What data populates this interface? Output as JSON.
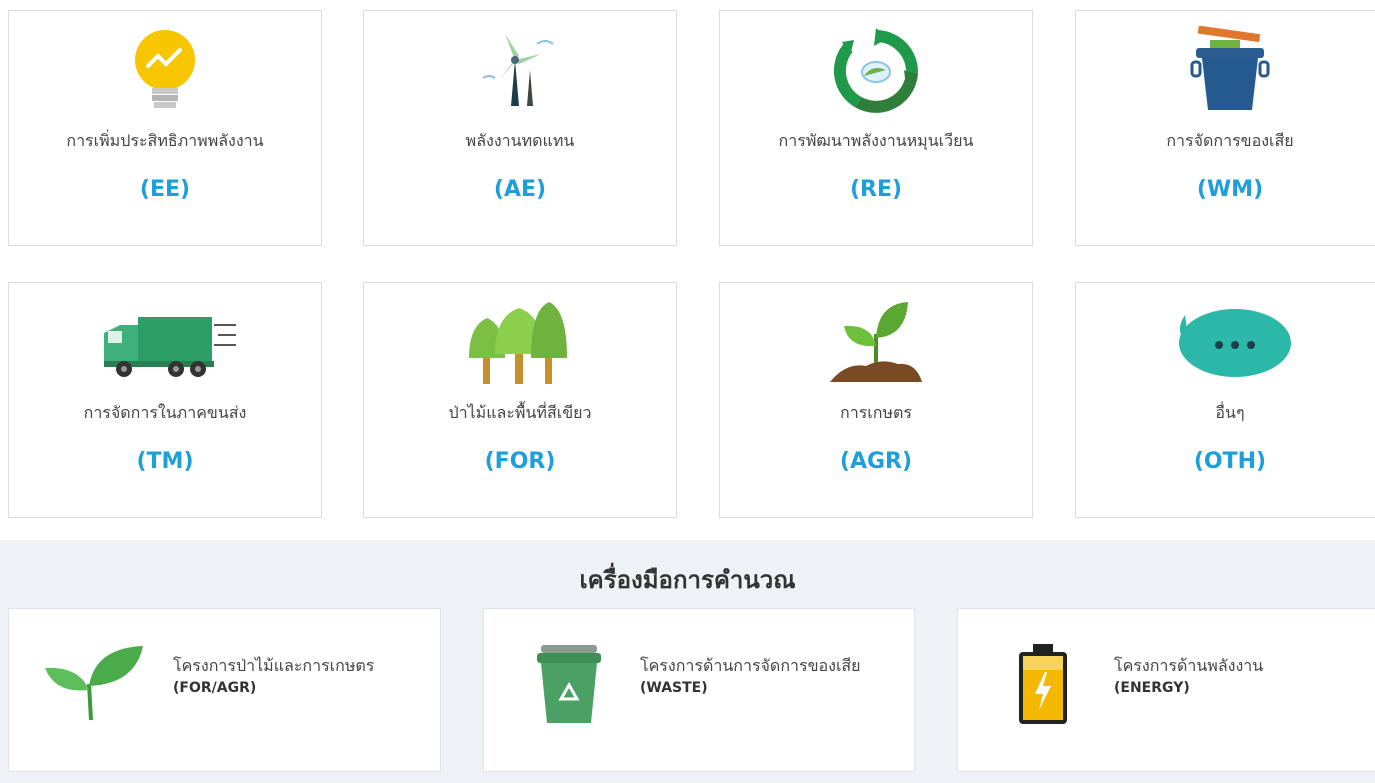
{
  "categories": [
    {
      "name": "การเพิ่มประสิทธิภาพพลังงาน",
      "code": "(EE)",
      "icon": "lightbulb-icon"
    },
    {
      "name": "พลังงานทดแทน",
      "code": "(AE)",
      "icon": "wind-turbine-icon"
    },
    {
      "name": "การพัฒนาพลังงานหมุนเวียน",
      "code": "(RE)",
      "icon": "recycle-energy-icon"
    },
    {
      "name": "การจัดการของเสีย",
      "code": "(WM)",
      "icon": "trash-bin-icon"
    },
    {
      "name": "การจัดการในภาคขนส่ง",
      "code": "(TM)",
      "icon": "truck-icon"
    },
    {
      "name": "ป่าไม้และพื้นที่สีเขียว",
      "code": "(FOR)",
      "icon": "trees-icon"
    },
    {
      "name": "การเกษตร",
      "code": "(AGR)",
      "icon": "sprout-soil-icon"
    },
    {
      "name": "อื่นๆ",
      "code": "(OTH)",
      "icon": "speech-bubble-icon"
    }
  ],
  "tools": {
    "title": "เครื่องมือการคำนวณ",
    "items": [
      {
        "name": "โครงการป่าไม้และการเกษตร",
        "code": "(FOR/AGR)",
        "icon": "leaf-sprout-icon"
      },
      {
        "name": "โครงการด้านการจัดการของเสีย",
        "code": "(WASTE)",
        "icon": "recycle-bin-icon"
      },
      {
        "name": "โครงการด้านพลังงาน",
        "code": "(ENERGY)",
        "icon": "battery-icon"
      }
    ]
  },
  "colors": {
    "accent": "#1e9fdc",
    "tools_bg": "#eef2f6"
  }
}
